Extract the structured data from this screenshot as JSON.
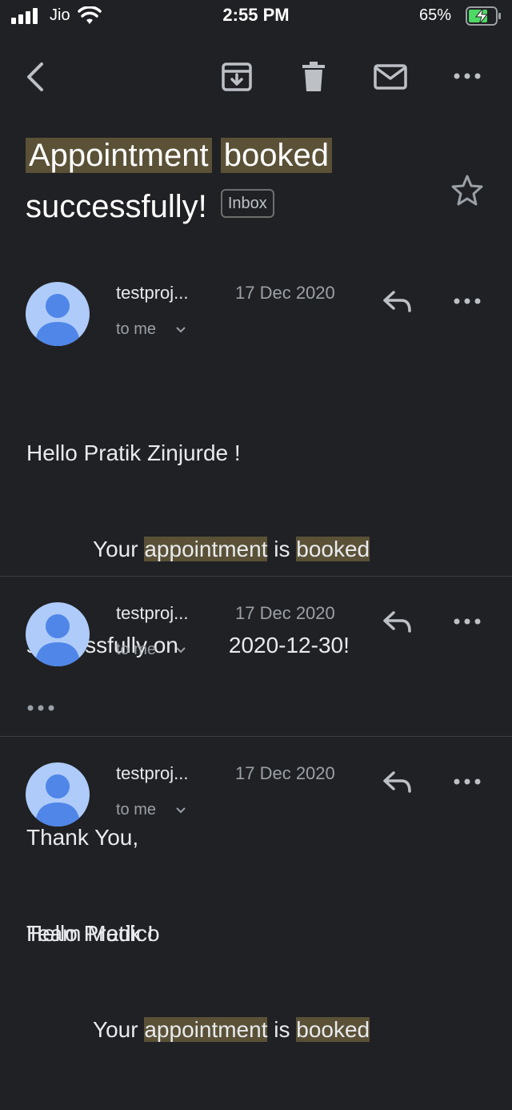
{
  "status_bar": {
    "carrier": "Jio",
    "time": "2:55 PM",
    "battery_pct": "65%"
  },
  "toolbar": {
    "back_icon": "back-arrow-icon",
    "archive_icon": "archive-icon",
    "delete_icon": "trash-icon",
    "mark_unread_icon": "mail-icon",
    "more_icon": "more-icon"
  },
  "subject": {
    "word1": "Appointment",
    "word2": "booked",
    "rest": "successfully!",
    "label": "Inbox"
  },
  "messages": [
    {
      "sender": "testproj...",
      "date": "17 Dec 2020",
      "recipient": "to me",
      "body": {
        "line1": "Hello Pratik Zinjurde !",
        "line2_prefix": "Your ",
        "hl1": "appointment",
        "mid": " is ",
        "hl2": "booked",
        "line3_a": "successfully on",
        "line3_b": "2020-12-30!",
        "line4": "Thank You,",
        "line5": "Team Medico"
      }
    },
    {
      "sender": "testproj...",
      "date": "17 Dec 2020",
      "recipient": "to me",
      "collapsed": "•••"
    },
    {
      "sender": "testproj...",
      "date": "17 Dec 2020",
      "recipient": "to me",
      "body": {
        "line1": "Hello Pratik !",
        "line2_prefix": "Your ",
        "hl1": "appointment",
        "mid": " is ",
        "hl2": "booked"
      }
    }
  ],
  "colors": {
    "background": "#202124",
    "highlight": "#5a5137",
    "avatar": "#aecbfa",
    "avatar_figure": "#4f86e8"
  }
}
